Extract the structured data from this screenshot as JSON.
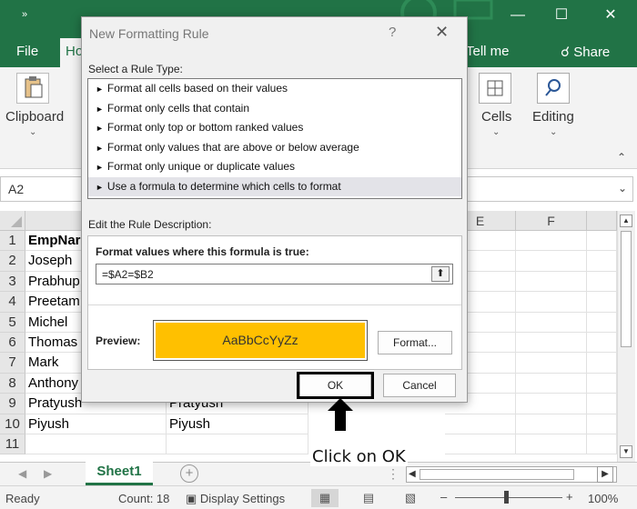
{
  "titlebar": {
    "qa_icon": "»",
    "minimize": "—",
    "restore": "☐",
    "close": "✕"
  },
  "tabs": {
    "file": "File",
    "home": "Ho",
    "tell_me": "Tell me",
    "share": "Share"
  },
  "ribbon": {
    "clipboard": "Clipboard",
    "cells": "Cells",
    "editing": "Editing"
  },
  "namebox": "A2",
  "columns": [
    "E",
    "F"
  ],
  "rows": [
    {
      "num": "1",
      "a": "EmpNar",
      "b": ""
    },
    {
      "num": "2",
      "a": "Joseph",
      "b": ""
    },
    {
      "num": "3",
      "a": "Prabhup",
      "b": ""
    },
    {
      "num": "4",
      "a": "Preetam",
      "b": ""
    },
    {
      "num": "5",
      "a": "Michel",
      "b": ""
    },
    {
      "num": "6",
      "a": "Thomas",
      "b": ""
    },
    {
      "num": "7",
      "a": "Mark",
      "b": ""
    },
    {
      "num": "8",
      "a": "Anthony",
      "b": ""
    },
    {
      "num": "9",
      "a": "Pratyush",
      "b": "Pratyush"
    },
    {
      "num": "10",
      "a": "Piyush",
      "b": "Piyush"
    },
    {
      "num": "11",
      "a": "",
      "b": ""
    }
  ],
  "sheet": {
    "tab": "Sheet1",
    "add": "+"
  },
  "status": {
    "ready": "Ready",
    "count": "Count: 18",
    "display_settings": "Display Settings",
    "zoom": "100%",
    "zoom_minus": "–",
    "zoom_plus": "+",
    "zoom_level": 0.5
  },
  "dialog": {
    "title": "New Formatting Rule",
    "help": "?",
    "close": "✕",
    "select_label": "Select a Rule Type:",
    "rule_types": [
      "Format all cells based on their values",
      "Format only cells that contain",
      "Format only top or bottom ranked values",
      "Format only values that are above or below average",
      "Format only unique or duplicate values",
      "Use a formula to determine which cells to format"
    ],
    "selected_index": 5,
    "edit_label": "Edit the Rule Description:",
    "formula_label": "Format values where this formula is true:",
    "formula_value": "=$A2=$B2",
    "preview_label": "Preview:",
    "preview_text": "AaBbCcYyZz",
    "preview_color": "#ffc000",
    "format_button": "Format...",
    "ok_button": "OK",
    "cancel_button": "Cancel"
  },
  "annotation": {
    "text": "Click on OK"
  }
}
